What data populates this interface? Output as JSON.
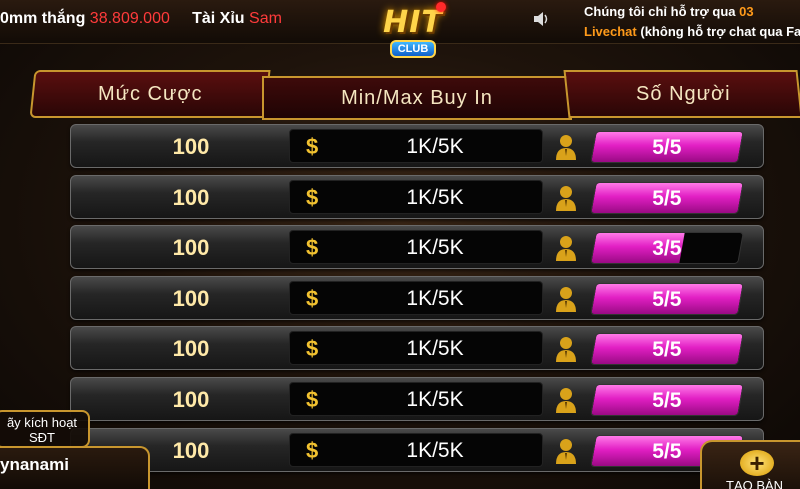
{
  "topbar": {
    "ticker_prefix": "0mm thắng",
    "ticker_amount": "38.809.000",
    "ticker_game": "Tài Xỉu",
    "ticker_user": "Sam",
    "support_line1": "Chúng tôi chỉ hỗ trợ qua",
    "support_line1_num": "03",
    "support_livechat": "Livechat",
    "support_line2": "(không hỗ trợ chat qua Fa",
    "logo_text": "HIT",
    "logo_sub": "CLUB",
    "speaker_icon": "speaker-icon"
  },
  "headers": {
    "bet": "Mức Cược",
    "buyin": "Min/Max Buy In",
    "players": "Số Người"
  },
  "rows": [
    {
      "bet": "100",
      "buyin": "1K/5K",
      "players": "5/5",
      "fill": 1.0
    },
    {
      "bet": "100",
      "buyin": "1K/5K",
      "players": "5/5",
      "fill": 1.0
    },
    {
      "bet": "100",
      "buyin": "1K/5K",
      "players": "3/5",
      "fill": 0.6
    },
    {
      "bet": "100",
      "buyin": "1K/5K",
      "players": "5/5",
      "fill": 1.0
    },
    {
      "bet": "100",
      "buyin": "1K/5K",
      "players": "5/5",
      "fill": 1.0
    },
    {
      "bet": "100",
      "buyin": "1K/5K",
      "players": "5/5",
      "fill": 1.0
    },
    {
      "bet": "100",
      "buyin": "1K/5K",
      "players": "5/5",
      "fill": 1.0
    }
  ],
  "bottom": {
    "activate_line1": "ãy kích hoạt",
    "activate_line2": "SĐT",
    "username": "ynanami",
    "create_label": "TẠO BÀN"
  }
}
